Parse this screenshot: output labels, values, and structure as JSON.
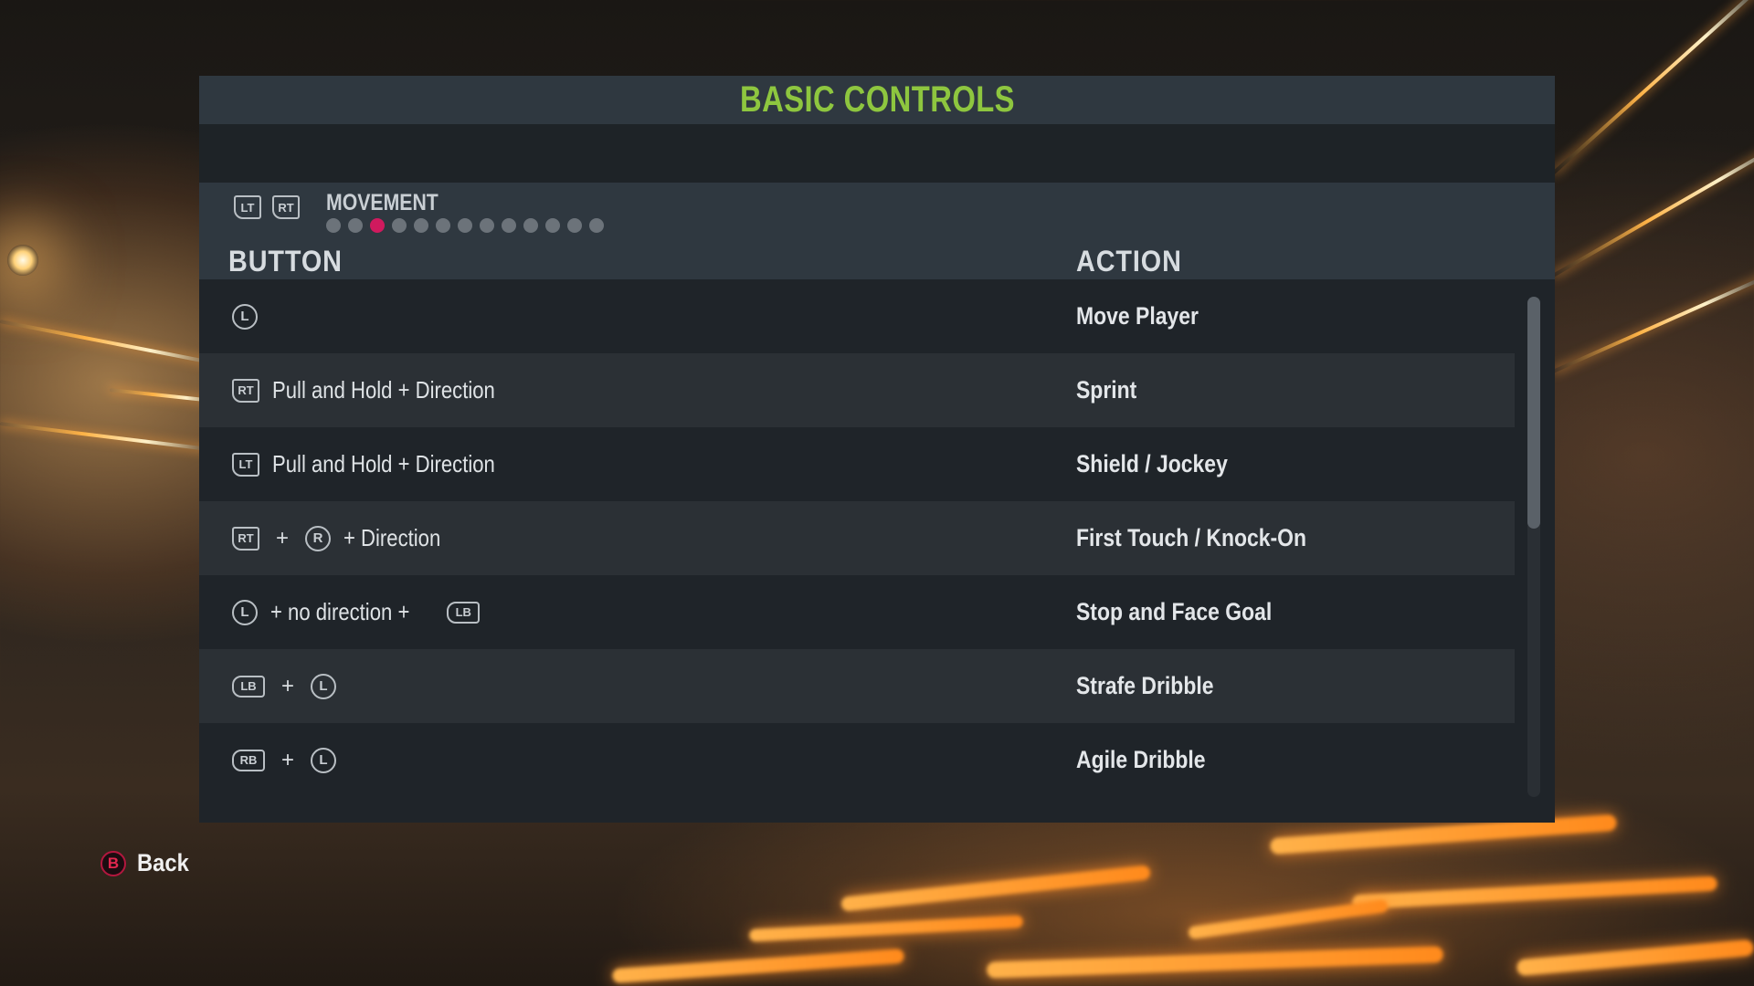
{
  "title": "BASIC CONTROLS",
  "section": {
    "name": "MOVEMENT",
    "prev_icon": "LT",
    "next_icon": "RT",
    "page_count": 13,
    "active_page": 3,
    "accent_color": "#d01a5e"
  },
  "columns": {
    "button": "BUTTON",
    "action": "ACTION"
  },
  "rows": [
    {
      "icon1": "L",
      "action": "Move Player"
    },
    {
      "icon1": "RT",
      "text": "Pull and Hold + Direction",
      "action": "Sprint"
    },
    {
      "icon1": "LT",
      "text": "Pull and Hold + Direction",
      "action": "Shield / Jockey"
    },
    {
      "icon1": "RT",
      "plus": "+",
      "icon2": "R",
      "text": "+ Direction",
      "action": "First Touch / Knock-On"
    },
    {
      "icon1": "L",
      "text": "+ no direction +",
      "icon2": "LB",
      "action": "Stop and Face Goal"
    },
    {
      "icon1": "LB",
      "plus": "+",
      "icon2": "L",
      "action": "Strafe Dribble"
    },
    {
      "icon1": "RB",
      "plus": "+",
      "icon2": "L",
      "action": "Agile Dribble"
    }
  ],
  "footer": {
    "back_icon": "B",
    "back_label": "Back"
  },
  "colors": {
    "title": "#8ec63f",
    "back_button": "#e2274f"
  }
}
